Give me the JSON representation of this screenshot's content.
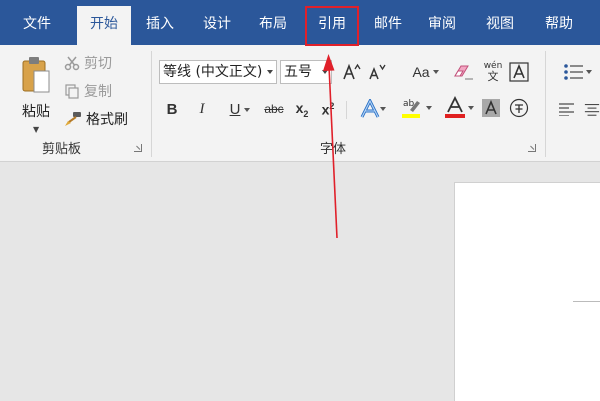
{
  "tabs": {
    "file": "文件",
    "home": "开始",
    "insert": "插入",
    "design": "设计",
    "layout": "布局",
    "references": "引用",
    "mailings": "邮件",
    "review": "审阅",
    "view": "视图",
    "help": "帮助"
  },
  "clipboard": {
    "paste": "粘贴",
    "cut": "剪切",
    "copy": "复制",
    "format_painter": "格式刷",
    "group_label": "剪贴板"
  },
  "font": {
    "font_name": "等线 (中文正文)",
    "font_size": "五号",
    "group_label": "字体",
    "change_case": "Aa",
    "strikethrough": "abc",
    "phonetic_top": "wén",
    "phonetic_bottom": "文",
    "highlight_color": "#ffff00",
    "font_color": "#e02020"
  },
  "colors": {
    "brand": "#2b579a",
    "annotation": "#e0202a"
  }
}
